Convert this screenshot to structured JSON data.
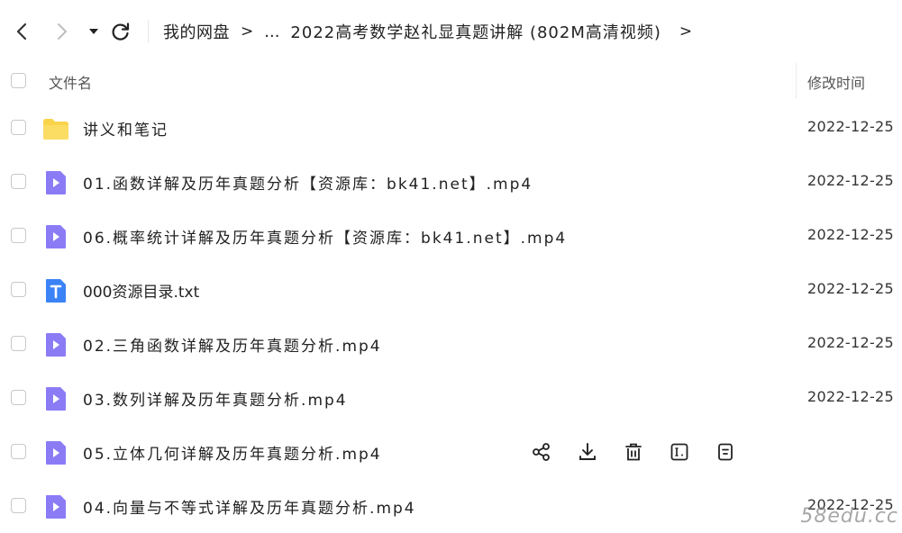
{
  "breadcrumb": {
    "root": "我的网盘",
    "sep": ">",
    "ellipsis": "...",
    "current": "2022高考数学赵礼显真题讲解 (802M高清视频)",
    "trail": ">"
  },
  "header": {
    "name_label": "文件名",
    "time_label": "修改时间"
  },
  "files": [
    {
      "name": "讲义和笔记",
      "date": "2022-12-25",
      "icon": "folder-icon"
    },
    {
      "name": "01.函数详解及历年真题分析【资源库：bk41.net】.mp4",
      "date": "2022-12-25",
      "icon": "video-file-icon"
    },
    {
      "name": "06.概率统计详解及历年真题分析【资源库：bk41.net】.mp4",
      "date": "2022-12-25",
      "icon": "video-file-icon"
    },
    {
      "name": "000资源目录.txt",
      "date": "2022-12-25",
      "icon": "text-file-icon"
    },
    {
      "name": "02.三角函数详解及历年真题分析.mp4",
      "date": "2022-12-25",
      "icon": "video-file-icon"
    },
    {
      "name": "03.数列详解及历年真题分析.mp4",
      "date": "2022-12-25",
      "icon": "video-file-icon"
    },
    {
      "name": "05.立体几何详解及历年真题分析.mp4",
      "date": "",
      "icon": "video-file-icon"
    },
    {
      "name": "04.向量与不等式详解及历年真题分析.mp4",
      "date": "2022-12-25",
      "icon": "video-file-icon"
    }
  ],
  "row_actions": [
    "share-icon",
    "download-icon",
    "delete-icon",
    "rename-icon",
    "more-icon"
  ],
  "colors": {
    "folder": "#F9D44A",
    "video": "#8B7CF6",
    "text_file": "#3B82F6",
    "checkbox_border": "#C8C8C8"
  },
  "watermark": "58edu.cc"
}
